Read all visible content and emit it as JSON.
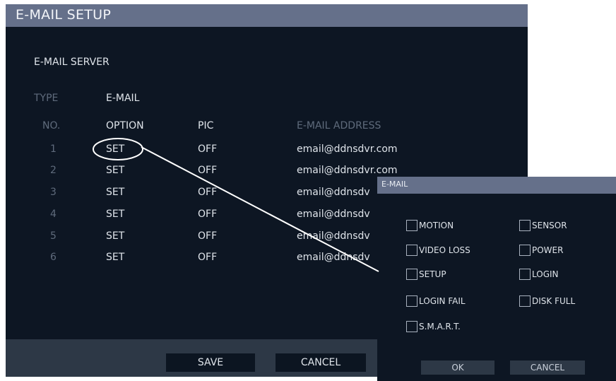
{
  "window": {
    "title": "E-MAIL SETUP"
  },
  "server": {
    "section_label": "E-MAIL SERVER",
    "type_label": "TYPE",
    "type_value": "E-MAIL"
  },
  "table": {
    "headers": {
      "no": "NO.",
      "option": "OPTION",
      "pic": "PIC",
      "address": "E-MAIL ADDRESS"
    },
    "rows": [
      {
        "no": "1",
        "option": "SET",
        "pic": "OFF",
        "address": "email@ddnsdvr.com"
      },
      {
        "no": "2",
        "option": "SET",
        "pic": "OFF",
        "address": "email@ddnsdvr.com"
      },
      {
        "no": "3",
        "option": "SET",
        "pic": "OFF",
        "address": "email@ddnsdv"
      },
      {
        "no": "4",
        "option": "SET",
        "pic": "OFF",
        "address": "email@ddnsdv"
      },
      {
        "no": "5",
        "option": "SET",
        "pic": "OFF",
        "address": "email@ddnsdv"
      },
      {
        "no": "6",
        "option": "SET",
        "pic": "OFF",
        "address": "email@ddnsdv"
      }
    ]
  },
  "buttons": {
    "save": "SAVE",
    "cancel": "CANCEL"
  },
  "popup": {
    "title": "E-MAIL",
    "checkboxes": {
      "motion": "MOTION",
      "sensor": "SENSOR",
      "video_loss": "VIDEO LOSS",
      "power": "POWER",
      "setup": "SETUP",
      "login": "LOGIN",
      "login_fail": "LOGIN FAIL",
      "disk_full": "DISK FULL",
      "smart": "S.M.A.R.T."
    },
    "ok": "OK",
    "cancel": "CANCEL"
  },
  "colors": {
    "title_bar": "#65708a",
    "panel_bg": "#0d1623",
    "bottom_bar": "#2d3846",
    "text_light": "#dfe4ea",
    "text_dim": "#5f6b7c"
  },
  "annotation": {
    "type": "callout-ellipse-with-leader-line",
    "target": "row-1-option-set"
  }
}
